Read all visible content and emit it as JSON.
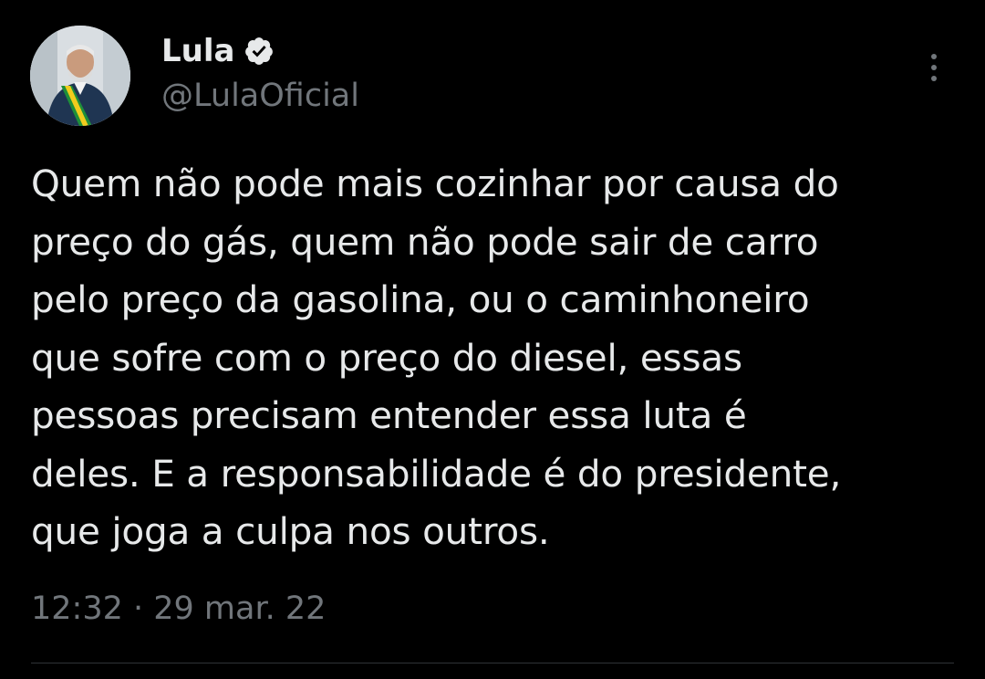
{
  "author": {
    "display_name": "Lula",
    "handle": "@LulaOficial",
    "verified": true,
    "verified_icon": "verified-badge-icon",
    "avatar_icon": "profile-photo"
  },
  "tweet": {
    "text": "Quem não pode mais cozinhar por causa do\npreço do gás, quem não pode sair de carro\npelo preço da gasolina, ou o caminhoneiro\nque sofre com o preço do diesel, essas\npessoas precisam entender essa luta é\ndeles. E a responsabilidade é do presidente,\nque joga a culpa nos outros.",
    "timestamp": "12:32 · 29 mar. 22"
  },
  "menu": {
    "icon": "more-options-icon"
  },
  "colors": {
    "background": "#000000",
    "primary_text": "#e7e9ea",
    "secondary_text": "#71767b",
    "divider": "#2f3336"
  }
}
